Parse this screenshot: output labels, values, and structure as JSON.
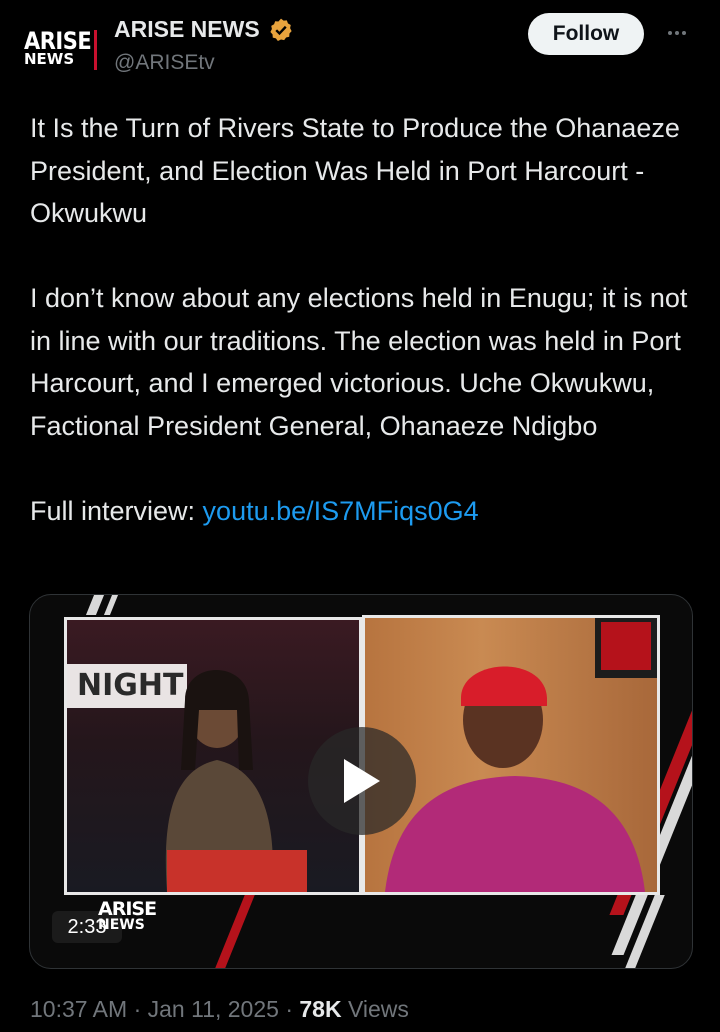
{
  "header": {
    "avatar_line1": "ARISE",
    "avatar_line2": "NEWS",
    "display_name": "ARISE NEWS",
    "handle": "@ARISEtv",
    "follow_label": "Follow",
    "verified_icon": "verified-badge-icon",
    "more_icon": "more-options-icon"
  },
  "tweet": {
    "headline": "It Is the Turn of Rivers State to Produce the Ohanaeze President, and Election Was Held in Port Harcourt -Okwukwu",
    "body": "I don’t know about any elections held in Enugu; it is not in line with our traditions. The election was held in Port Harcourt, and I emerged victorious. Uche Okwukwu, Factional President General, Ohanaeze Ndigbo",
    "interview_prefix": "Full interview: ",
    "interview_link": "youtu.be/IS7MFiqs0G4"
  },
  "media": {
    "duration": "2:33",
    "left_panel_label": "NIGHT",
    "bug_line1": "ARISE",
    "bug_line2": "NEWS",
    "play_icon": "play-icon"
  },
  "footer": {
    "time": "10:37 AM",
    "separator": "·",
    "date": "Jan 11, 2025",
    "views_count": "78K",
    "views_label": "Views"
  },
  "colors": {
    "background": "#000000",
    "text": "#e7e9ea",
    "muted": "#71767b",
    "link": "#1d9bf0",
    "verified": "#e8a33d"
  }
}
